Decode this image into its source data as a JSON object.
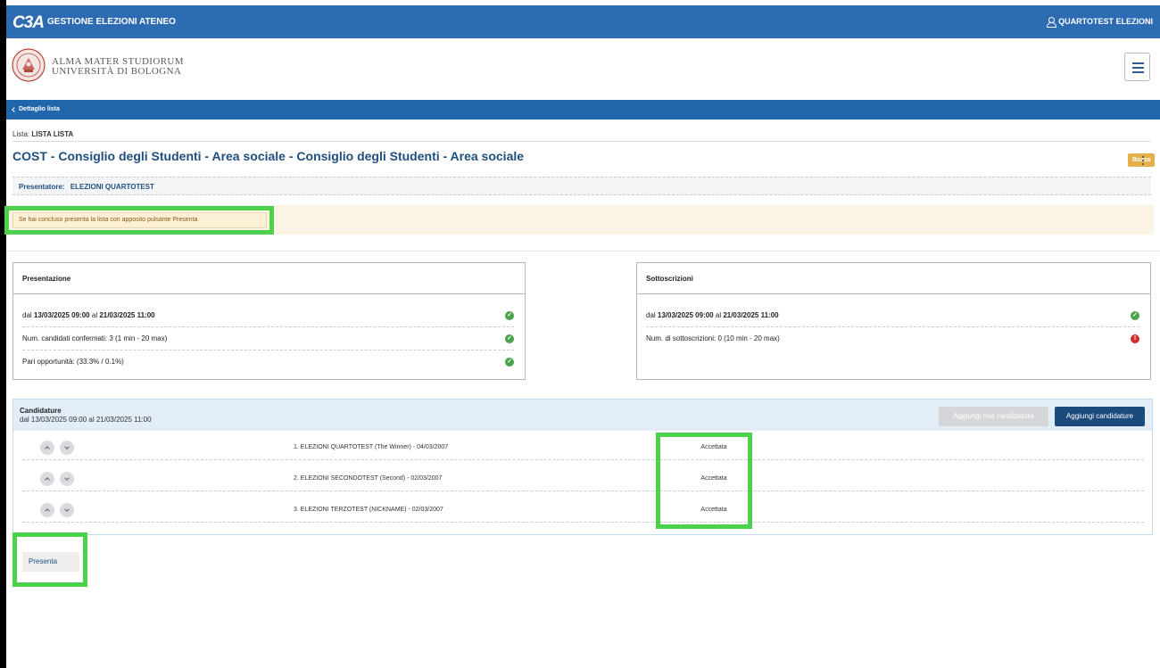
{
  "topbar": {
    "logo": "C3A",
    "title": "GESTIONE ELEZIONI ATENEO",
    "user": "QUARTOTEST ELEZIONI",
    "color": "#2d6bb3"
  },
  "brand": {
    "line1": "ALMA MATER STUDIORUM",
    "line2": "UNIVERSITÀ DI BOLOGNA",
    "menu_icon": "hamburger-icon"
  },
  "nav": {
    "back_label": "Dettaglio lista",
    "back_icon": "chevron-left-icon"
  },
  "list": {
    "prefix": "Lista: ",
    "name": "LISTA LISTA",
    "title": "COST - Consiglio degli Studenti - Area sociale - Consiglio degli Studenti - Area sociale",
    "status_badge": "Bozza",
    "presenter_label": "Presentatore:",
    "presenter_name": "ELEZIONI QUARTOTEST"
  },
  "alert": {
    "text": "Se hai concluso presenta la lista con apposito pulsante Presenta"
  },
  "presentazione": {
    "title": "Presentazione",
    "rows": [
      {
        "pre": "dal ",
        "d1": "13/03/2025 09:00",
        "mid": " al ",
        "d2": "21/03/2025 11:00",
        "status": "ok"
      },
      {
        "text": "Num. candidati confermati: 3 (1 min - 20 max)",
        "status": "ok"
      },
      {
        "text": "Pari opportunità: (33.3% / 0.1%)",
        "status": "ok"
      }
    ]
  },
  "sottoscrizioni": {
    "title": "Sottoscrizioni",
    "rows": [
      {
        "pre": "dal ",
        "d1": "13/03/2025 09:00",
        "mid": " al ",
        "d2": "21/03/2025 11:00",
        "status": "ok"
      },
      {
        "text": "Num. di sottoscrizioni: 0 (10 min - 20 max)",
        "status": "error",
        "error_glyph": "!"
      }
    ]
  },
  "candidature": {
    "title": "Candidature",
    "subtitle": "dal 13/03/2025 09:00 al 21/03/2025 11:00",
    "btn_mia": "Aggiungi mia candidatura",
    "btn_add": "Aggiungi candidature",
    "rows": [
      {
        "name": "1. ELEZIONI QUARTOTEST (The Winner) - 04/03/2007",
        "state": "Accettata"
      },
      {
        "name": "2. ELEZIONI SECONDOTEST (Second) - 02/03/2007",
        "state": "Accettata"
      },
      {
        "name": "3. ELEZIONI TERZOTEST (NICKNAME) - 02/03/2007",
        "state": "Accettata"
      }
    ]
  },
  "footer": {
    "presenta_label": "Presenta"
  },
  "colors": {
    "accent": "#1b4a7d",
    "highlight": "#4cd14c",
    "ok": "#49a34b",
    "error": "#d32f2f",
    "badge": "#e5b04a"
  }
}
